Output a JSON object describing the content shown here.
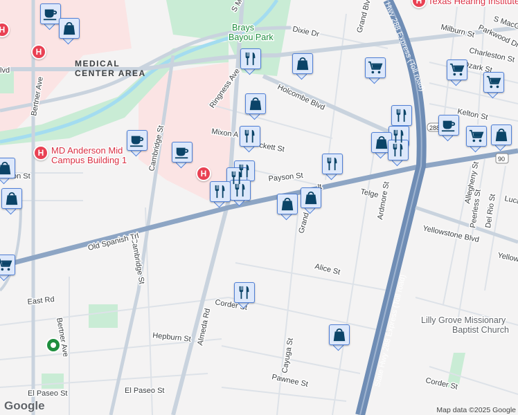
{
  "map": {
    "area_label_line1": "MEDICAL",
    "area_label_line2": "CENTER AREA",
    "park_line1": "Brays",
    "park_line2": "Bayou Park",
    "poi_hospital_line1": "MD Anderson Mid",
    "poi_hospital_line2": "Campus Building 1",
    "poi_texas_hearing": "Texas Hearing Institute",
    "poi_church_line1": "Lilly Grove Missionary",
    "poi_church_line2": "Baptist Church",
    "highway_label": "State Hwy 288 Express (Toll road)",
    "highway_label_top": "Hwy 288 Express (Toll road)",
    "shield_288": "288",
    "shield_90": "90",
    "hospital_glyph": "H",
    "streets": {
      "blvd": "lvd",
      "bertner_top": "Bertner Ave",
      "bertner_bottom": "Bertner Ave",
      "cambridge_top": "Cambridge St",
      "cambridge_bottom": "Cambridge St",
      "ringness": "Ringness Ave",
      "mixon": "Mixon A",
      "ckett": "ckett St",
      "holcombe": "Holcombe Blvd",
      "dixie": "Dixie Dr",
      "grand_top": "Grand Blvd",
      "grand_mid": "Grand",
      "payson": "Payson St",
      "telge": "Telge",
      "ardmore": "Ardmore St",
      "old_spanish": "Old Spanish Trl",
      "alt": "lt",
      "almeda": "Almeda Rd",
      "alice": "Alice St",
      "corder_left": "Corder St",
      "corder_right": "Corder St",
      "east": "East Rd",
      "hepburn": "Hepburn St",
      "cayuga": "Cayuga St",
      "pawnee": "Pawnee St",
      "el_paseo_1": "El Paseo St",
      "el_paseo_2": "El Paseo St",
      "on_st": "on St",
      "yellowstone": "Yellowstone Blvd",
      "yellow": "Yellow",
      "milburn": "Milburn St",
      "parkwood": "Parkwood Dr",
      "charleston": "Charleston St",
      "ozark": "Ozark St",
      "kelton": "Kelton St",
      "s_mac": "S MacG",
      "s_m": "S M",
      "allegheny": "Allegheny St",
      "peerless": "Peerless St",
      "del_rio": "Del Rio St",
      "lucas": "Luca"
    },
    "marker_icons": [
      "coffee-icon",
      "shopping-bag-icon",
      "restaurant-icon",
      "shopping-cart-icon"
    ]
  },
  "colors": {
    "marker_fill": "#dde8fb",
    "marker_border": "#4f7fd6",
    "icon": "#0b4468",
    "hospital": "#e94153",
    "highway": "#7b96bb"
  },
  "footer": {
    "logo": "Google",
    "attribution": "Map data ©2025 Google"
  }
}
